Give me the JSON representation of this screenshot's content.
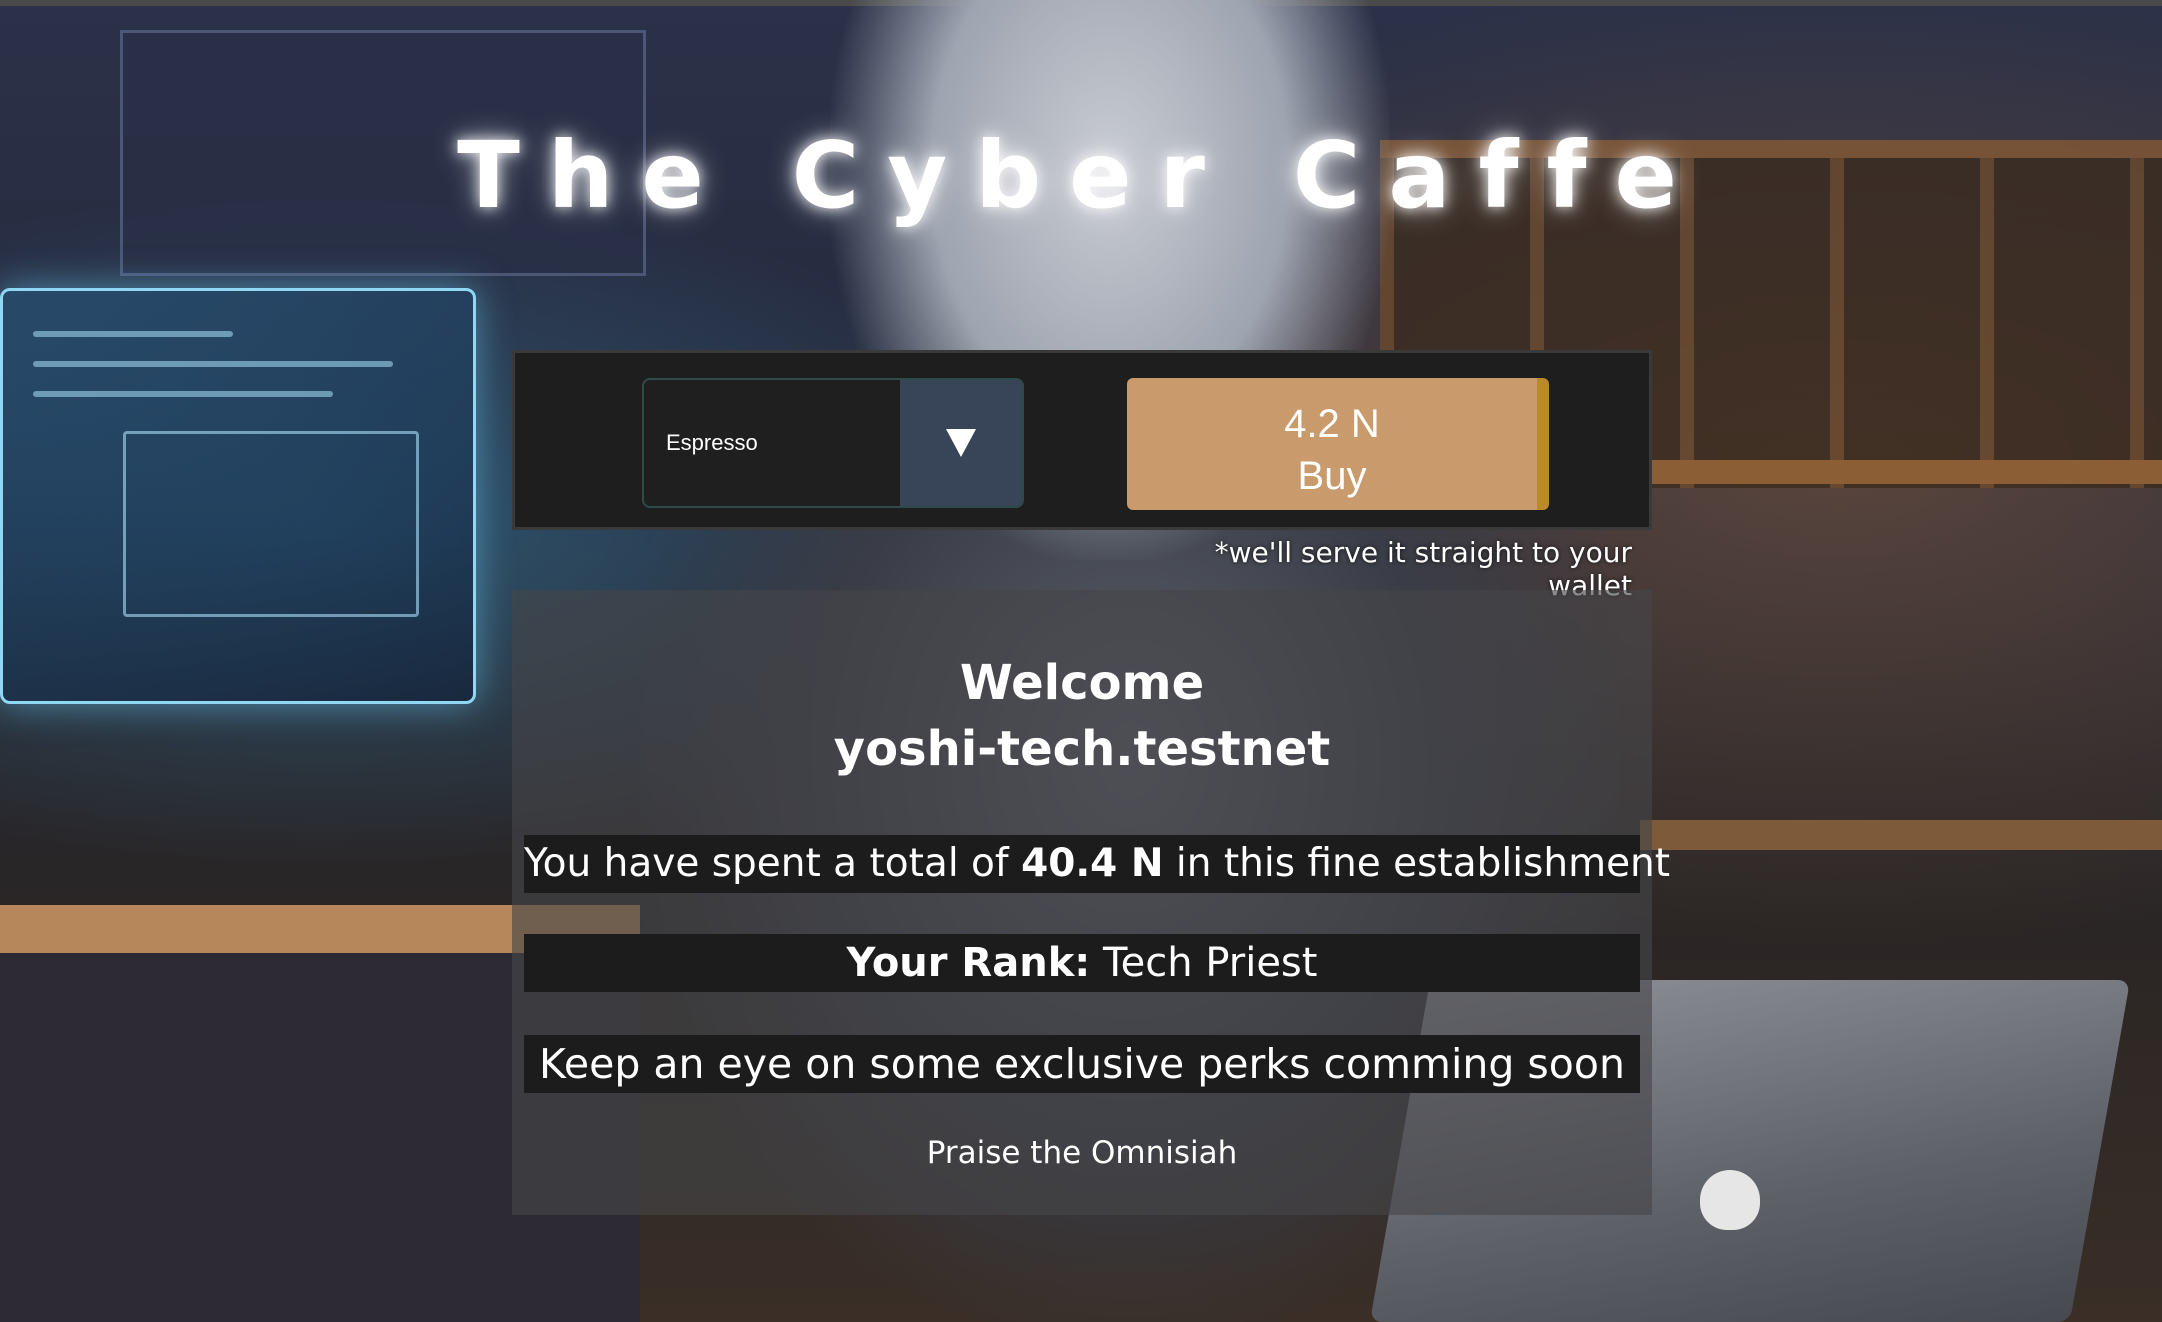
{
  "page": {
    "title": "The Cyber Caffe"
  },
  "order": {
    "selected_drink": "Espresso",
    "price": "4.2 N",
    "buy_label": "Buy",
    "note": "*we'll serve it straight to your wallet"
  },
  "welcome": {
    "greeting": "Welcome",
    "account": "yoshi-tech.testnet",
    "spent_prefix": "You have spent a total of",
    "spent_amount": "40.4 N",
    "spent_suffix": "in this fine establishment",
    "rank_label": "Your Rank:",
    "rank_value": "Tech Priest",
    "perks_text": "Keep an eye on some exclusive perks comming soon",
    "praise_text": "Praise the Omnisiah"
  },
  "colors": {
    "buy_button": "#c99a6c",
    "buy_button_edge": "#b88a28",
    "select_arrow_bg": "#384559",
    "panel_bg": "#1e1e1e"
  },
  "icons": {
    "select_arrow": "triangle-down-icon"
  }
}
